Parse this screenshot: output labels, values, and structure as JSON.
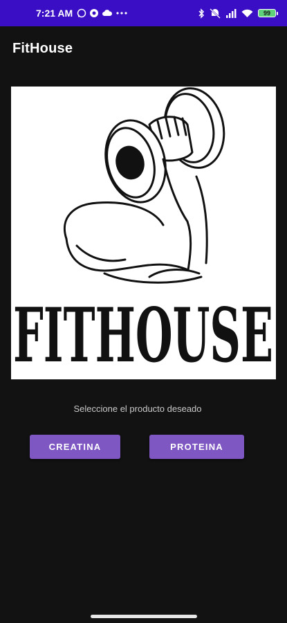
{
  "status_bar": {
    "time": "7:21 AM",
    "battery": "99",
    "left_icons": [
      "whatsapp-icon",
      "app-icon",
      "cloud-icon",
      "more-icon"
    ],
    "right_icons": [
      "bluetooth-icon",
      "mute-icon",
      "signal-icon",
      "wifi-icon",
      "battery-icon"
    ]
  },
  "app_bar": {
    "title": "FitHouse"
  },
  "logo": {
    "brand_text": "FITHOUSE"
  },
  "main": {
    "prompt": "Seleccione el producto deseado",
    "buttons": {
      "creatina": "CREATINA",
      "proteina": "PROTEINA"
    }
  },
  "colors": {
    "status_bar": "#3a0ec4",
    "background": "#121212",
    "accent": "#7e57c2",
    "battery_fill": "#5fd17a"
  }
}
